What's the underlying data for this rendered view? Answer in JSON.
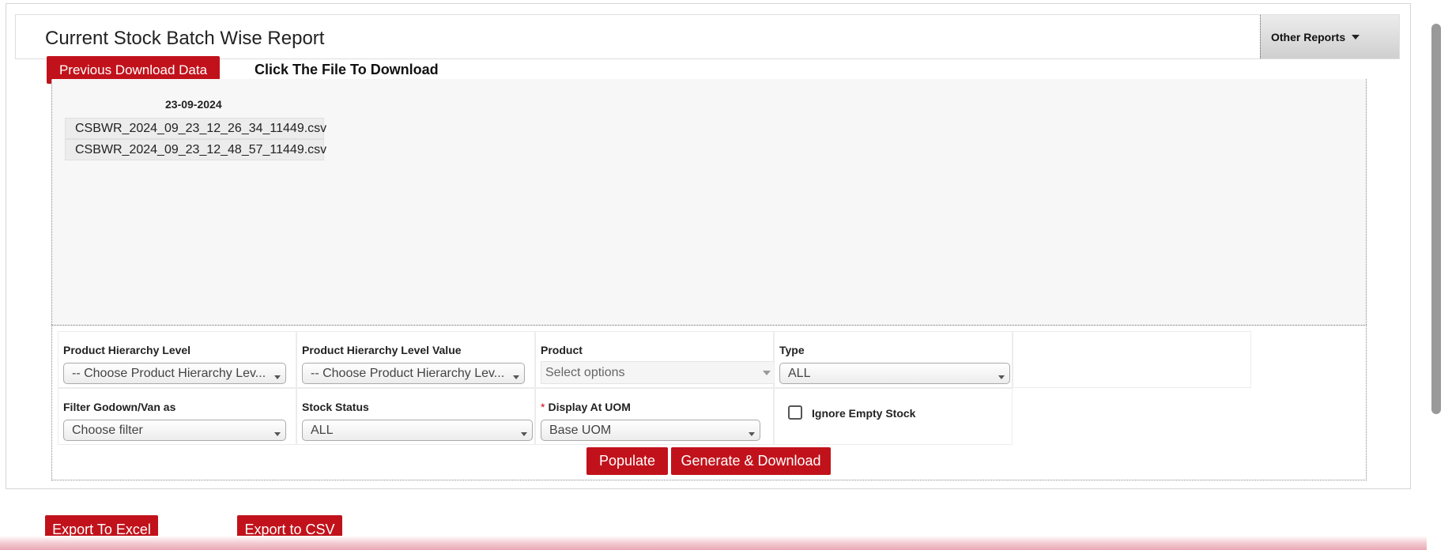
{
  "header": {
    "title": "Current Stock Batch Wise Report",
    "other_reports_label": "Other Reports"
  },
  "download": {
    "previous_button_label": "Previous Download Data",
    "click_label": "Click The File To Download",
    "date": "23-09-2024",
    "files": [
      "CSBWR_2024_09_23_12_26_34_11449.csv",
      "CSBWR_2024_09_23_12_48_57_11449.csv"
    ]
  },
  "filters": {
    "product_hierarchy_level": {
      "label": "Product Hierarchy Level",
      "value": "-- Choose Product Hierarchy Lev..."
    },
    "product_hierarchy_level_value": {
      "label": "Product Hierarchy Level Value",
      "value": "-- Choose Product Hierarchy Lev..."
    },
    "product": {
      "label": "Product",
      "placeholder": "Select options"
    },
    "type": {
      "label": "Type",
      "value": "ALL"
    },
    "filter_godown": {
      "label": "Filter Godown/Van as",
      "value": "Choose filter"
    },
    "stock_status": {
      "label": "Stock Status",
      "value": "ALL"
    },
    "display_uom": {
      "required_mark": "*",
      "label": "Display At UOM",
      "value": "Base UOM"
    },
    "ignore_empty_stock": {
      "label": "Ignore Empty Stock",
      "checked": false
    }
  },
  "actions": {
    "populate_label": "Populate",
    "generate_label": "Generate & Download",
    "export_excel_label": "Export To Excel",
    "export_csv_label": "Export to CSV"
  },
  "colors": {
    "accent": "#c1121b",
    "panel_bg": "#f7f7f7"
  },
  "icons": {
    "dropdown": "caret-down-icon"
  }
}
